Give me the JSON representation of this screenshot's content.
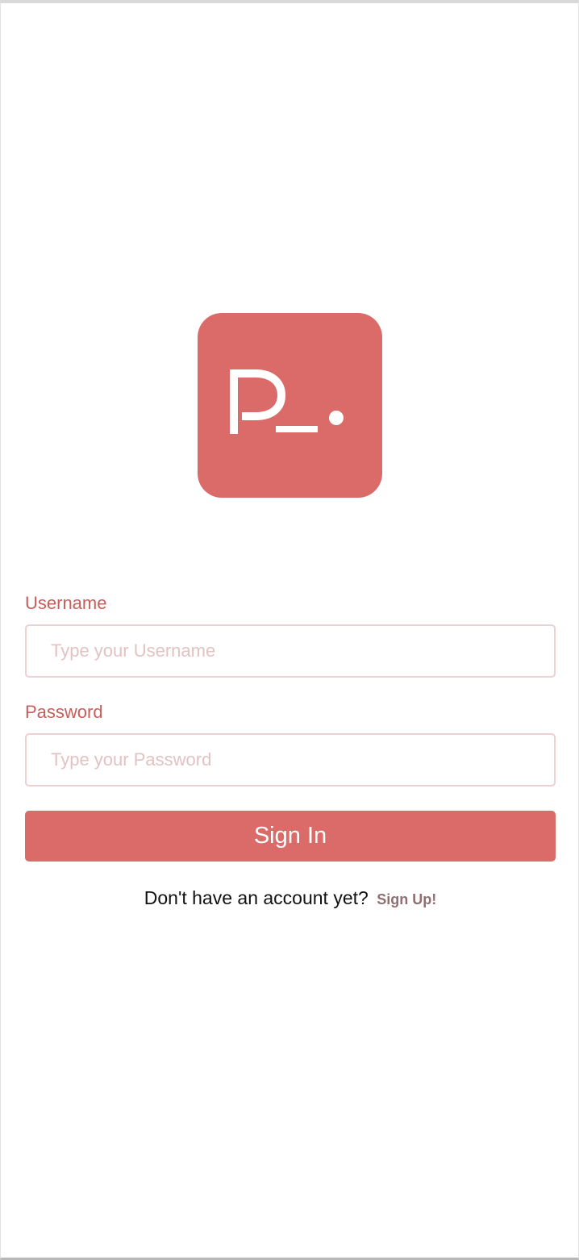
{
  "app": {
    "logo_name": "app-logo",
    "logo_text": "P_."
  },
  "form": {
    "username_label": "Username",
    "username_placeholder": "Type your Username",
    "password_label": "Password",
    "password_placeholder": "Type your Password",
    "signin_label": "Sign In"
  },
  "footer": {
    "prompt": "Don't have an account yet?",
    "signup_link": "Sign Up!"
  },
  "colors": {
    "accent": "#da6b68",
    "label": "#c75e5b",
    "input_border": "#ebd1d1",
    "placeholder": "#e3c2c2",
    "link": "#8f6f71"
  }
}
